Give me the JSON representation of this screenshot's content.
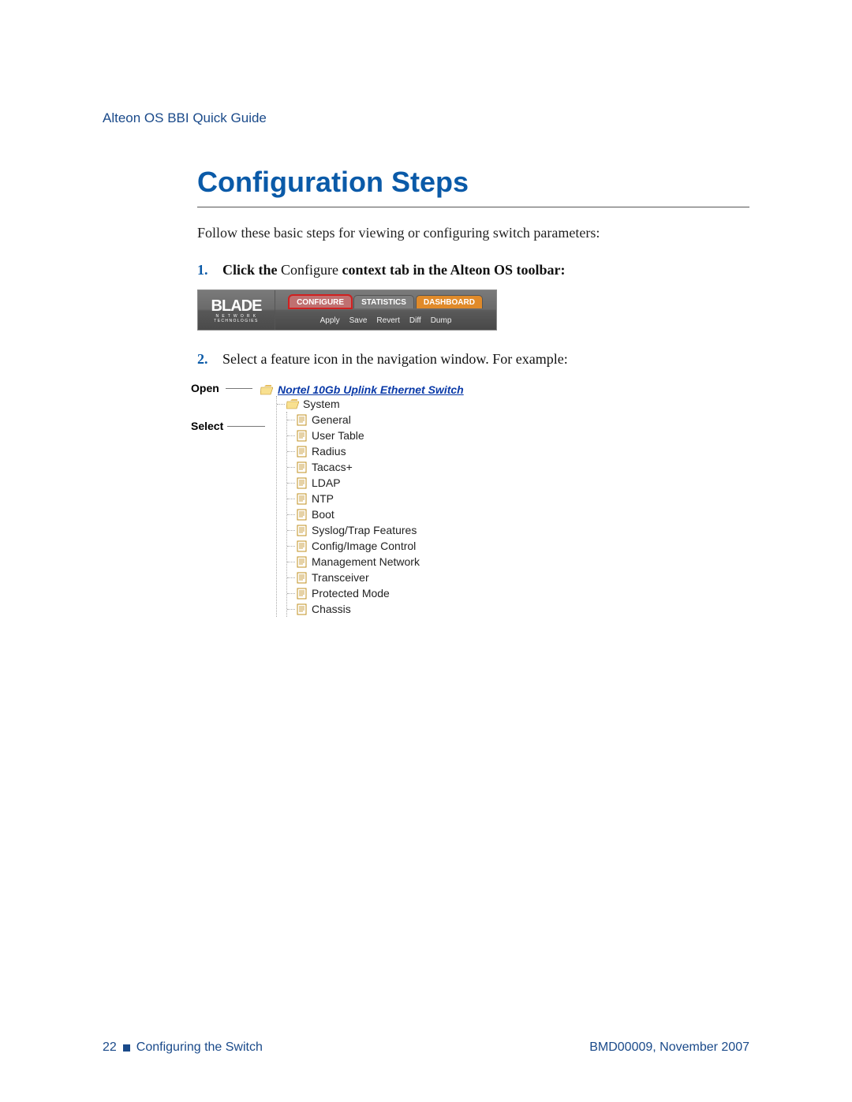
{
  "header": {
    "guide_title": "Alteon OS  BBI Quick Guide"
  },
  "title": "Configuration Steps",
  "intro": "Follow these basic steps for viewing or configuring switch parameters:",
  "steps": [
    {
      "num": "1.",
      "parts": {
        "p1": "Click the ",
        "p2": "Configure",
        "p3": " context tab in the Alteon OS toolbar:"
      }
    },
    {
      "num": "2.",
      "text": "Select a feature icon in the navigation window. For example:"
    }
  ],
  "toolbar": {
    "logo": {
      "main": "BLADE",
      "sub1": "N E T W O R K",
      "sub2": "TECHNOLOGIES"
    },
    "tabs": {
      "configure": "CONFIGURE",
      "statistics": "STATISTICS",
      "dashboard": "DASHBOARD"
    },
    "buttons": {
      "apply": "Apply",
      "save": "Save",
      "revert": "Revert",
      "diff": "Diff",
      "dump": "Dump"
    }
  },
  "tree": {
    "callouts": {
      "open": "Open",
      "select": "Select"
    },
    "root": "Nortel 10Gb Uplink Ethernet Switch",
    "system": "System",
    "items": [
      "General",
      "User Table",
      "Radius",
      "Tacacs+",
      "LDAP",
      "NTP",
      "Boot",
      "Syslog/Trap Features",
      "Config/Image Control",
      "Management Network",
      "Transceiver",
      "Protected Mode",
      "Chassis"
    ]
  },
  "footer": {
    "page_num": "22",
    "section": "Configuring the Switch",
    "docid": "BMD00009, November 2007"
  }
}
